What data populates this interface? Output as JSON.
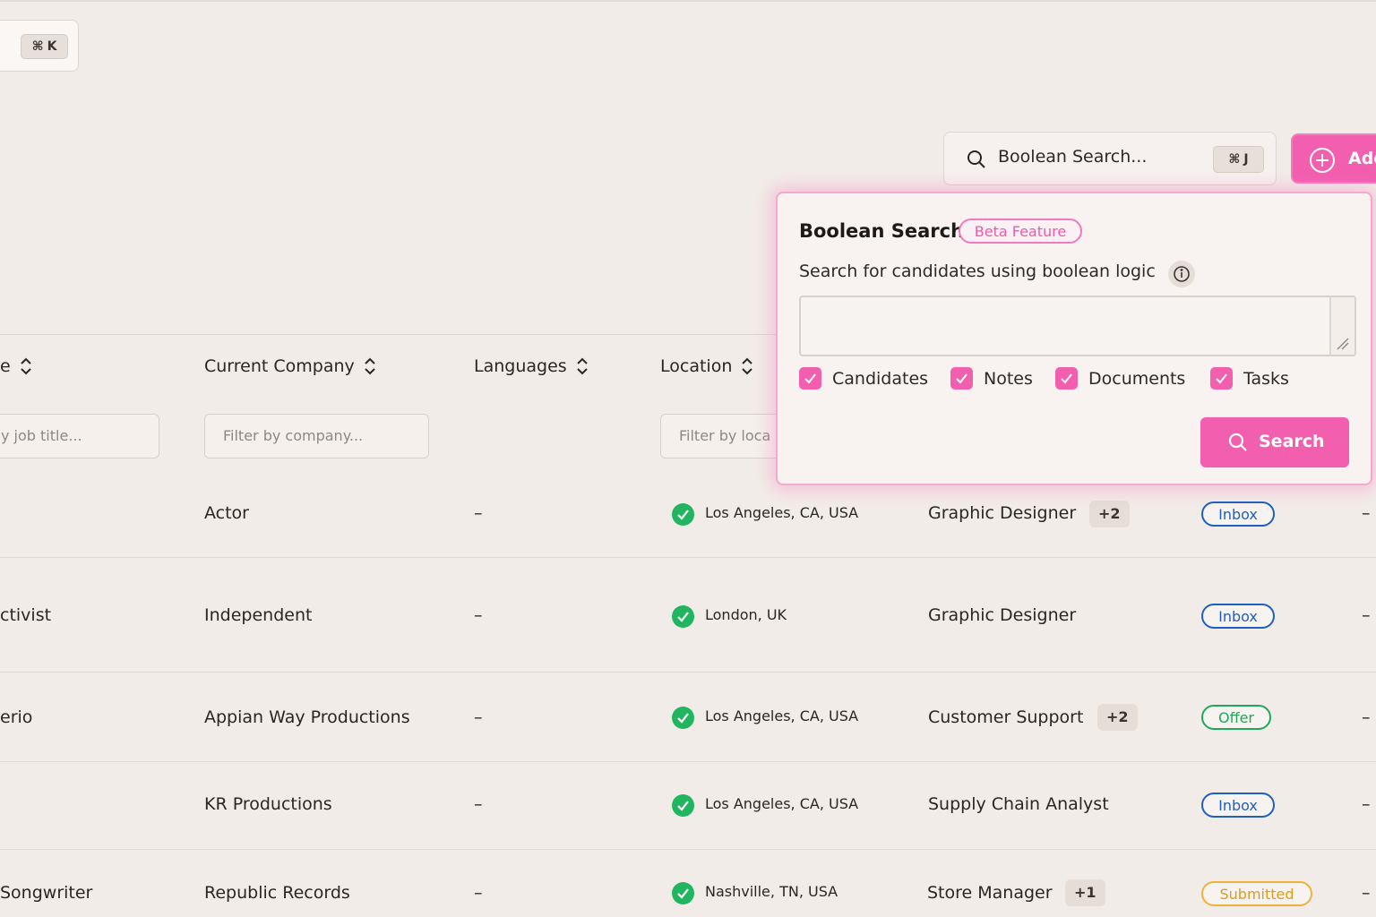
{
  "global_search": {
    "shortcut_symbol": "⌘",
    "shortcut_key": "K"
  },
  "boolean_trigger": {
    "placeholder": "Boolean Search...",
    "shortcut_symbol": "⌘",
    "shortcut_key": "J"
  },
  "add_button": {
    "label": "Add"
  },
  "table": {
    "columns": [
      {
        "label": "e"
      },
      {
        "label": "Current Company"
      },
      {
        "label": "Languages"
      },
      {
        "label": "Location"
      }
    ],
    "filters": {
      "job_title_placeholder": "y job title...",
      "company_placeholder": "Filter by company...",
      "location_placeholder": "Filter by loca"
    },
    "rows": [
      {
        "title": "",
        "company": "Actor",
        "languages": "–",
        "location": "Los Angeles, CA, USA",
        "job": "Graphic Designer",
        "job_extra": "+2",
        "status": "Inbox",
        "last": "–"
      },
      {
        "title": "ctivist",
        "company": "Independent",
        "languages": "–",
        "location": "London, UK",
        "job": "Graphic Designer",
        "job_extra": "",
        "status": "Inbox",
        "last": "–"
      },
      {
        "title": "erio",
        "company": "Appian Way Productions",
        "languages": "–",
        "location": "Los Angeles, CA, USA",
        "job": "Customer Support",
        "job_extra": "+2",
        "status": "Offer",
        "last": "–"
      },
      {
        "title": "",
        "company": "KR Productions",
        "languages": "–",
        "location": "Los Angeles, CA, USA",
        "job": "Supply Chain Analyst",
        "job_extra": "",
        "status": "Inbox",
        "last": "–"
      },
      {
        "title": "Songwriter",
        "company": "Republic Records",
        "languages": "–",
        "location": "Nashville, TN, USA",
        "job": "Store Manager",
        "job_extra": "+1",
        "status": "Submitted",
        "last": "–"
      }
    ]
  },
  "popover": {
    "title": "Boolean Search",
    "badge": "Beta Feature",
    "description": "Search for candidates using boolean logic",
    "query_value": "",
    "options": [
      {
        "label": "Candidates",
        "checked": true
      },
      {
        "label": "Notes",
        "checked": true
      },
      {
        "label": "Documents",
        "checked": true
      },
      {
        "label": "Tasks",
        "checked": true
      }
    ],
    "search_label": "Search"
  },
  "colors": {
    "accent": "#f25fae",
    "success": "#22b560",
    "inbox": "#1f5fbf",
    "offer": "#1fa85a",
    "submitted": "#f0b23a"
  }
}
